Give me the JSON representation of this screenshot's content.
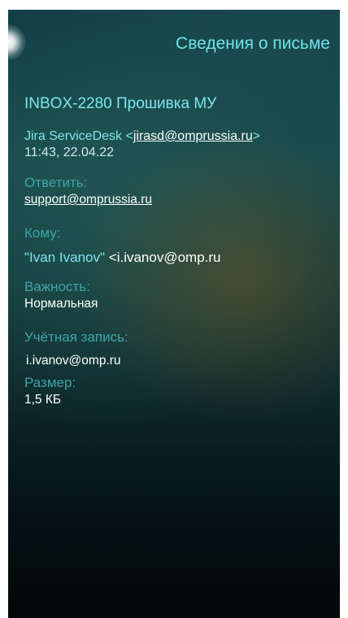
{
  "header": {
    "title": "Сведения о письме"
  },
  "message": {
    "subject": "INBOX-2280 Прошивка МУ",
    "sender_name": "Jira ServiceDesk",
    "sender_email": "jirasd@omprussia.ru",
    "datetime": "11:43, 22.04.22"
  },
  "reply_to": {
    "label": "Ответить:",
    "email": "support@omprussia.ru"
  },
  "recipient": {
    "label": "Кому:",
    "name": "\"Ivan Ivanov\"",
    "email": "i.ivanov@omp.ru"
  },
  "importance": {
    "label": "Важность:",
    "value": "Нормальная"
  },
  "account": {
    "label": "Учётная запись:",
    "value": "i.ivanov@omp.ru"
  },
  "size": {
    "label": "Размер:",
    "value": "1,5 КБ"
  },
  "colors": {
    "accent": "#6fe3e6",
    "label": "#3fa5a8",
    "value": "#ffffff",
    "background_top": "#123e44",
    "background_bottom": "#020708"
  }
}
